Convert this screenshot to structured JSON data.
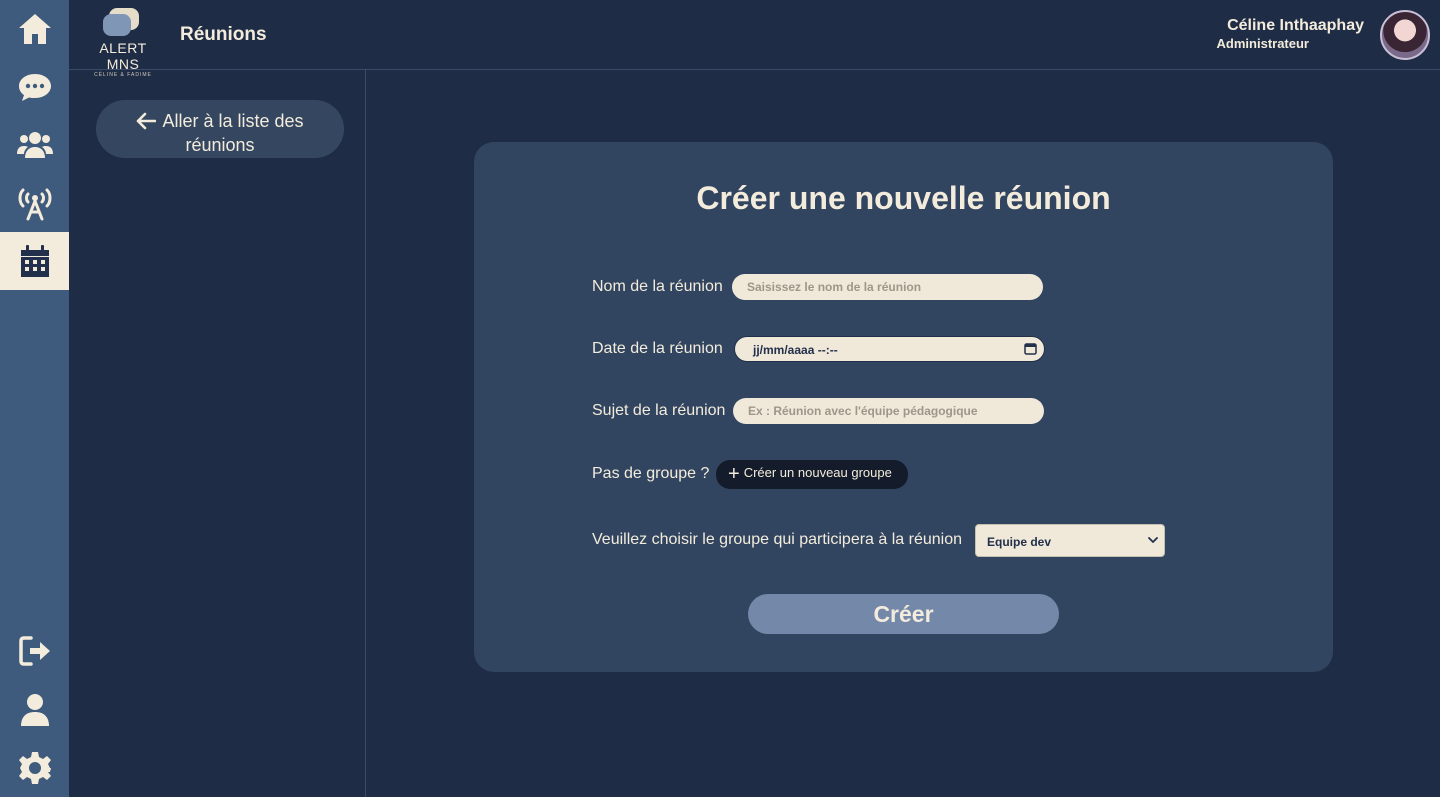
{
  "nav": {
    "items": [
      {
        "icon": "home-icon"
      },
      {
        "icon": "chat-icon"
      },
      {
        "icon": "group-icon"
      },
      {
        "icon": "broadcast-icon"
      },
      {
        "icon": "calendar-icon",
        "active": true
      }
    ],
    "bottom_items": [
      {
        "icon": "logout-icon"
      },
      {
        "icon": "user-icon"
      },
      {
        "icon": "gear-icon"
      }
    ]
  },
  "header": {
    "logo_text": "ALERT MNS",
    "logo_sub": "CÉLINE & FADIME",
    "title": "Réunions",
    "user_name": "Céline Inthaaphay",
    "user_role": "Administrateur"
  },
  "sidepanel": {
    "back_label_line1": "Aller à la liste des",
    "back_label_line2": "réunions"
  },
  "form": {
    "title": "Créer une nouvelle réunion",
    "name_label": "Nom de la réunion",
    "name_placeholder": "Saisissez le nom de la réunion",
    "date_label": "Date de la réunion",
    "date_value": "jj/mm/aaaa  --:--",
    "subject_label": "Sujet de la réunion",
    "subject_placeholder": "Ex : Réunion avec l'équipe pédagogique",
    "no_group_label": "Pas de groupe ?",
    "new_group_button": "Créer un nouveau groupe",
    "group_label": "Veuillez choisir le groupe qui participera à la réunion",
    "group_selected": "Equipe dev",
    "submit_label": "Créer"
  },
  "colors": {
    "background": "#1f2c45",
    "rail": "#3e5a7d",
    "card": "#324560",
    "text": "#f3ecdc",
    "submit": "#7489a9"
  }
}
